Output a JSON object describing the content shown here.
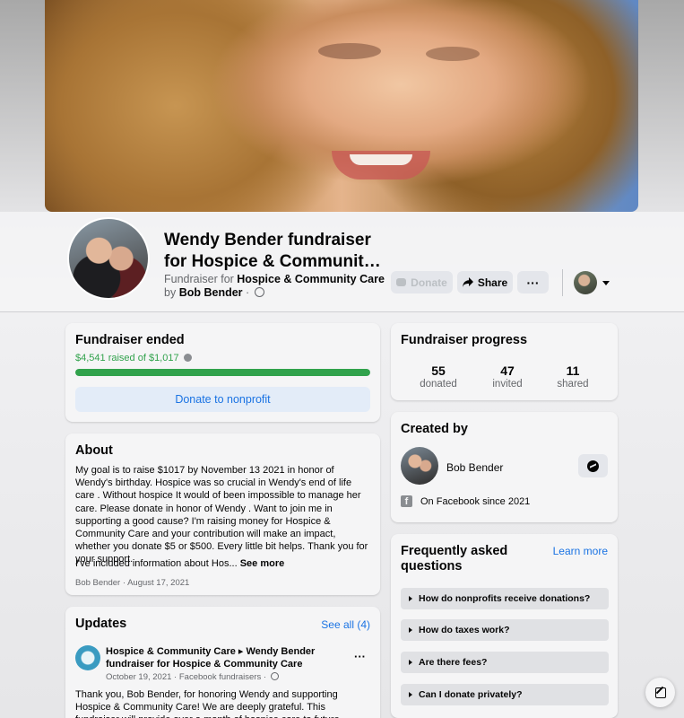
{
  "header": {
    "title_line1": "Wendy Bender fundraiser",
    "title_line2": "for Hospice & Community Care",
    "fundraiser_for_prefix": "Fundraiser for ",
    "nonprofit": "Hospice & Community Care",
    "by_prefix": "by ",
    "organizer": "Bob Bender",
    "privacy_sep": " · ",
    "buttons": {
      "donate": "Donate",
      "share": "Share",
      "more": "···"
    }
  },
  "ended_card": {
    "title": "Fundraiser ended",
    "raised_text": "$4,541 raised of $1,017",
    "progress_fraction": 1.0,
    "donate_button": "Donate to nonprofit"
  },
  "about_card": {
    "title": "About",
    "text": "My goal is to raise $1017 by November 13 2021 in honor of Wendy's birthday. Hospice was so crucial in Wendy's end of life care . Without hospice It would of been impossible to manage her care. Please donate in honor of Wendy . Want to join me in supporting a good cause? I'm raising money for Hospice & Community Care and your contribution will make an impact, whether you donate $5 or $500. Every little bit helps. Thank you for your support.",
    "more_text": "I've included information about Hos...",
    "see_more": "See more",
    "meta": "Bob Bender · August 17, 2021"
  },
  "updates_card": {
    "title": "Updates",
    "see_all": "See all (4)",
    "post_title": "Hospice & Community Care ▸ Wendy Bender fundraiser for Hospice & Community Care",
    "post_meta": "October 19, 2021 · Facebook fundraisers · ",
    "post_more": "···",
    "post_text": "Thank you, Bob Bender, for honoring Wendy and supporting Hospice & Community Care!  We are deeply grateful.  This fundraiser will provide over a month of hospice care to future"
  },
  "progress_card": {
    "title": "Fundraiser progress",
    "stats": [
      {
        "value": "55",
        "label": "donated"
      },
      {
        "value": "47",
        "label": "invited"
      },
      {
        "value": "11",
        "label": "shared"
      }
    ]
  },
  "created_card": {
    "title": "Created by",
    "name": "Bob Bender",
    "since": "On Facebook since 2021"
  },
  "faq_card": {
    "title": "Frequently asked questions",
    "learn_more": "Learn more",
    "items": [
      "How do nonprofits receive donations?",
      "How do taxes work?",
      "Are there fees?",
      "Can I donate privately?"
    ]
  },
  "colors": {
    "accent_blue": "#1a73e3",
    "progress_green": "#31a24c"
  },
  "icons": [
    "globe-icon",
    "share-arrow-icon",
    "donate-icon",
    "info-icon",
    "messenger-icon",
    "facebook-icon",
    "compose-icon",
    "caret-down-icon",
    "chevron-right-icon"
  ]
}
